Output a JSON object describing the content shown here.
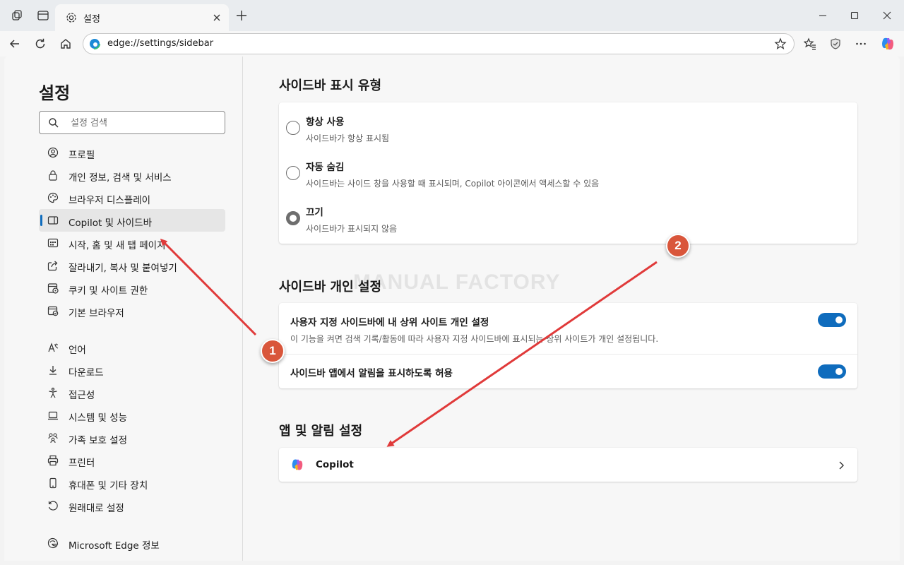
{
  "browser": {
    "tab_title": "설정",
    "url": "edge://settings/sidebar"
  },
  "sidebar": {
    "title": "설정",
    "search_placeholder": "설정 검색",
    "items": [
      {
        "label": "프로필",
        "icon": "profile-icon"
      },
      {
        "label": "개인 정보, 검색 및 서비스",
        "icon": "lock-icon"
      },
      {
        "label": "브라우저 디스플레이",
        "icon": "palette-icon"
      },
      {
        "label": "Copilot 및 사이드바",
        "icon": "sidebar-icon",
        "active": true
      },
      {
        "label": "시작, 홈 및 새 탭 페이지",
        "icon": "home-grid-icon"
      },
      {
        "label": "잘라내기, 복사 및 붙여넣기",
        "icon": "share-icon"
      },
      {
        "label": "쿠키 및 사이트 권한",
        "icon": "cookie-icon"
      },
      {
        "label": "기본 브라우저",
        "icon": "browser-icon"
      },
      {
        "label": "언어",
        "icon": "language-icon"
      },
      {
        "label": "다운로드",
        "icon": "download-icon"
      },
      {
        "label": "접근성",
        "icon": "accessibility-icon"
      },
      {
        "label": "시스템 및 성능",
        "icon": "laptop-icon"
      },
      {
        "label": "가족 보호 설정",
        "icon": "family-icon"
      },
      {
        "label": "프린터",
        "icon": "printer-icon"
      },
      {
        "label": "휴대폰 및 기타 장치",
        "icon": "phone-icon"
      },
      {
        "label": "원래대로 설정",
        "icon": "reset-icon"
      },
      {
        "label": "Microsoft Edge 정보",
        "icon": "edge-icon"
      }
    ]
  },
  "main": {
    "display_type": {
      "title": "사이드바 표시 유형",
      "options": [
        {
          "title": "항상 사용",
          "desc": "사이드바가 항상 표시됨",
          "checked": false
        },
        {
          "title": "자동 숨김",
          "desc": "사이드바는 사이드 창을 사용할 때 표시되며, Copilot 아이콘에서 액세스할 수 있음",
          "checked": false
        },
        {
          "title": "끄기",
          "desc": "사이드바가 표시되지 않음",
          "checked": true
        }
      ]
    },
    "personalization": {
      "title": "사이드바 개인 설정",
      "rows": [
        {
          "title": "사용자 지정 사이드바에 내 상위 사이트 개인 설정",
          "desc": "이 기능을 켜면 검색 기록/활동에 따라 사용자 지정 사이드바에 표시되는 상위 사이트가 개인 설정됩니다.",
          "on": true
        },
        {
          "title": "사이드바 앱에서 알림을 표시하도록 허용",
          "on": true
        }
      ]
    },
    "apps": {
      "title": "앱 및 알림 설정",
      "items": [
        {
          "label": "Copilot"
        }
      ]
    }
  },
  "watermark": "MANUAL FACTORY",
  "annotations": {
    "badge1": "1",
    "badge2": "2"
  },
  "colors": {
    "accent": "#0f6cbd",
    "annotation": "#e03a3a",
    "badge": "#d9563b"
  }
}
